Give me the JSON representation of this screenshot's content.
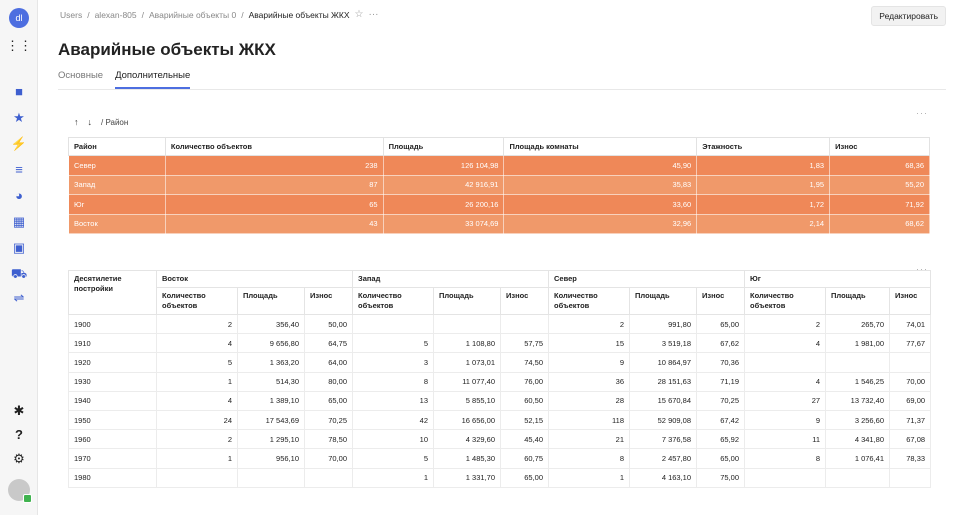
{
  "colors": {
    "accent": "#4d6ee0",
    "row_orange": "#ef8858",
    "row_orange_alt": "#f0996a"
  },
  "sidebar": {
    "icons": [
      {
        "name": "app-logo-icon",
        "glyph": "dl"
      },
      {
        "name": "apps-grid-icon",
        "glyph": "⋮⋮"
      },
      {
        "name": "folder-icon",
        "glyph": "■"
      },
      {
        "name": "star-icon",
        "glyph": "★"
      },
      {
        "name": "bolt-icon",
        "glyph": "⚡"
      },
      {
        "name": "list-icon",
        "glyph": "≡"
      },
      {
        "name": "pie-icon",
        "glyph": "◕"
      },
      {
        "name": "dashboard-icon",
        "glyph": "▦"
      },
      {
        "name": "datasets-icon",
        "glyph": "▣"
      },
      {
        "name": "cart-icon",
        "glyph": "⛟"
      },
      {
        "name": "settings-sliders-icon",
        "glyph": "⇌"
      },
      {
        "name": "bug-icon",
        "glyph": "✱"
      },
      {
        "name": "help-icon",
        "glyph": "?"
      },
      {
        "name": "gear-icon",
        "glyph": "⚙"
      }
    ]
  },
  "header": {
    "breadcrumb": [
      "Users",
      "/",
      "alexan-805",
      "/",
      "Аварийные объекты 0",
      "/",
      "Аварийные объекты ЖКХ"
    ],
    "star": "☆",
    "more": "···",
    "edit_button": "Редактировать"
  },
  "page": {
    "title": "Аварийные объекты ЖКХ",
    "tabs": [
      "Основные",
      "Дополнительные"
    ]
  },
  "table1": {
    "more": "···",
    "sort_up": "↑",
    "sort_down": "↓",
    "path": "/  Район",
    "headers": [
      "Район",
      "Количество объектов",
      "Площадь",
      "Площадь комнаты",
      "Этажность",
      "Износ"
    ],
    "rows": [
      [
        "Север",
        "238",
        "126 104,98",
        "45,90",
        "1,83",
        "68,36"
      ],
      [
        "Запад",
        "87",
        "42 916,91",
        "35,83",
        "1,95",
        "55,20"
      ],
      [
        "Юг",
        "65",
        "26 200,16",
        "33,60",
        "1,72",
        "71,92"
      ],
      [
        "Восток",
        "43",
        "33 074,69",
        "32,96",
        "2,14",
        "68,62"
      ]
    ]
  },
  "table2": {
    "more": "···",
    "corner_header": "Десятилетие постройки",
    "groups": [
      "Восток",
      "Запад",
      "Север",
      "Юг"
    ],
    "sub_headers": [
      "Количество объектов",
      "Площадь",
      "Износ"
    ],
    "rows": [
      [
        "1900",
        "2",
        "356,40",
        "50,00",
        "",
        "",
        "",
        "2",
        "991,80",
        "65,00",
        "2",
        "265,70",
        "74,01"
      ],
      [
        "1910",
        "4",
        "9 656,80",
        "64,75",
        "5",
        "1 108,80",
        "57,75",
        "15",
        "3 519,18",
        "67,62",
        "4",
        "1 981,00",
        "77,67"
      ],
      [
        "1920",
        "5",
        "1 363,20",
        "64,00",
        "3",
        "1 073,01",
        "74,50",
        "9",
        "10 864,97",
        "70,36",
        "",
        "",
        ""
      ],
      [
        "1930",
        "1",
        "514,30",
        "80,00",
        "8",
        "11 077,40",
        "76,00",
        "36",
        "28 151,63",
        "71,19",
        "4",
        "1 546,25",
        "70,00"
      ],
      [
        "1940",
        "4",
        "1 389,10",
        "65,00",
        "13",
        "5 855,10",
        "60,50",
        "28",
        "15 670,84",
        "70,25",
        "27",
        "13 732,40",
        "69,00"
      ],
      [
        "1950",
        "24",
        "17 543,69",
        "70,25",
        "42",
        "16 656,00",
        "52,15",
        "118",
        "52 909,08",
        "67,42",
        "9",
        "3 256,60",
        "71,37"
      ],
      [
        "1960",
        "2",
        "1 295,10",
        "78,50",
        "10",
        "4 329,60",
        "45,40",
        "21",
        "7 376,58",
        "65,92",
        "11",
        "4 341,80",
        "67,08"
      ],
      [
        "1970",
        "1",
        "956,10",
        "70,00",
        "5",
        "1 485,30",
        "60,75",
        "8",
        "2 457,80",
        "65,00",
        "8",
        "1 076,41",
        "78,33"
      ],
      [
        "1980",
        "",
        "",
        "",
        "1",
        "1 331,70",
        "65,00",
        "1",
        "4 163,10",
        "75,00",
        "",
        "",
        ""
      ]
    ]
  }
}
